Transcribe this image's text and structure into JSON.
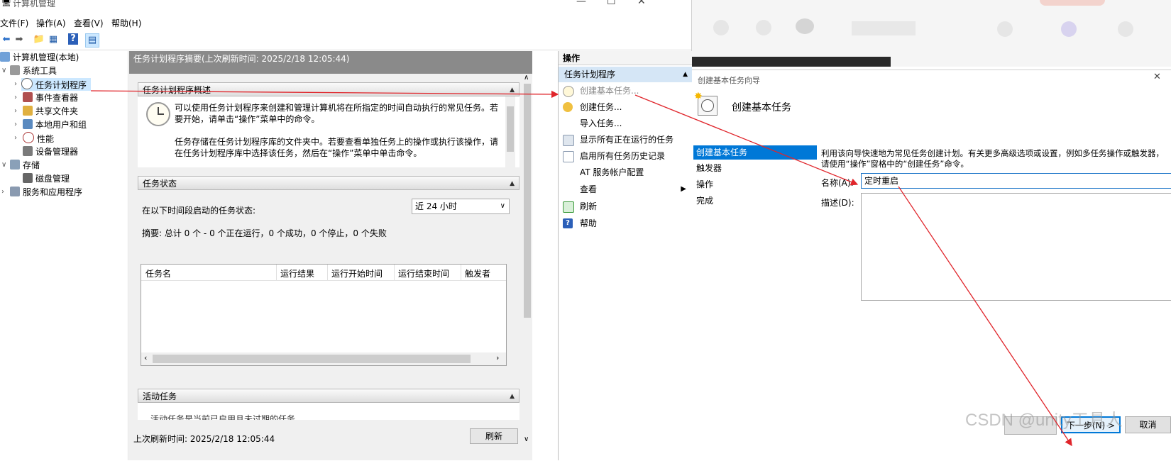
{
  "left_window": {
    "title": "计算机管理",
    "menu": [
      "文件(F)",
      "操作(A)",
      "查看(V)",
      "帮助(H)"
    ],
    "tree": [
      {
        "label": "计算机管理(本地)",
        "icon": "computer-icon"
      },
      {
        "label": "系统工具",
        "icon": "tools-icon"
      },
      {
        "label": "任务计划程序",
        "icon": "clock-icon"
      },
      {
        "label": "事件查看器",
        "icon": "event-viewer-icon"
      },
      {
        "label": "共享文件夹",
        "icon": "shared-folder-icon"
      },
      {
        "label": "本地用户和组",
        "icon": "users-icon"
      },
      {
        "label": "性能",
        "icon": "performance-icon"
      },
      {
        "label": "设备管理器",
        "icon": "device-manager-icon"
      },
      {
        "label": "存储",
        "icon": "storage-icon"
      },
      {
        "label": "磁盘管理",
        "icon": "disk-icon"
      },
      {
        "label": "服务和应用程序",
        "icon": "services-icon"
      }
    ],
    "center": {
      "header": "任务计划程序摘要(上次刷新时间: 2025/2/18 12:05:44)",
      "overview_title": "任务计划程序概述",
      "overview_p1": "可以使用任务计划程序来创建和管理计算机将在所指定的时间自动执行的常见任务。若要开始，请单击“操作”菜单中的命令。",
      "overview_p2": "任务存储在任务计划程序库的文件夹中。若要查看单独任务上的操作或执行该操作，请在任务计划程序库中选择该任务，然后在“操作”菜单中单击命令。",
      "status_title": "任务状态",
      "status_label": "在以下时间段启动的任务状态:",
      "status_period": "近 24 小时",
      "summary": "摘要: 总计 0 个 - 0 个正在运行，0 个成功，0 个停止，0 个失败",
      "table_columns": [
        "任务名",
        "运行结果",
        "运行开始时间",
        "运行结束时间",
        "触发者"
      ],
      "active_title": "活动任务",
      "active_desc": "活动任务是当前已启用且未过期的任务。",
      "footer_refresh_time": "上次刷新时间: 2025/2/18 12:05:44",
      "refresh_button": "刷新"
    },
    "actions": {
      "title": "操作",
      "group": "任务计划程序",
      "items": [
        {
          "label": "创建基本任务...",
          "icon": "create-basic-task-icon"
        },
        {
          "label": "创建任务...",
          "icon": "create-task-icon"
        },
        {
          "label": "导入任务...",
          "icon": ""
        },
        {
          "label": "显示所有正在运行的任务",
          "icon": "running-tasks-icon"
        },
        {
          "label": "启用所有任务历史记录",
          "icon": "history-icon"
        },
        {
          "label": "AT 服务帐户配置",
          "icon": ""
        },
        {
          "label": "查看",
          "icon": ""
        },
        {
          "label": "刷新",
          "icon": "refresh-icon"
        },
        {
          "label": "帮助",
          "icon": "help-icon"
        }
      ]
    }
  },
  "wizard": {
    "window_title": "创建基本任务向导",
    "heading": "创建基本任务",
    "steps": [
      "创建基本任务",
      "触发器",
      "操作",
      "完成"
    ],
    "intro": "利用该向导快速地为常见任务创建计划。有关更多高级选项或设置，例如多任务操作或触发器，请使用“操作”窗格中的“创建任务”命令。",
    "name_label": "名称(A):",
    "name_value": "定时重启",
    "desc_label": "描述(D):",
    "next_button": "下一步(N) >",
    "cancel_button": "取消"
  },
  "watermark": "CSDN @unity工具人",
  "colors": {
    "selection": "#cce8ff",
    "actions_group_bg": "#d5e6f6",
    "wizard_step_selected": "#0078d7",
    "arrow": "#e0252b",
    "center_header": "#8a8a8a"
  }
}
